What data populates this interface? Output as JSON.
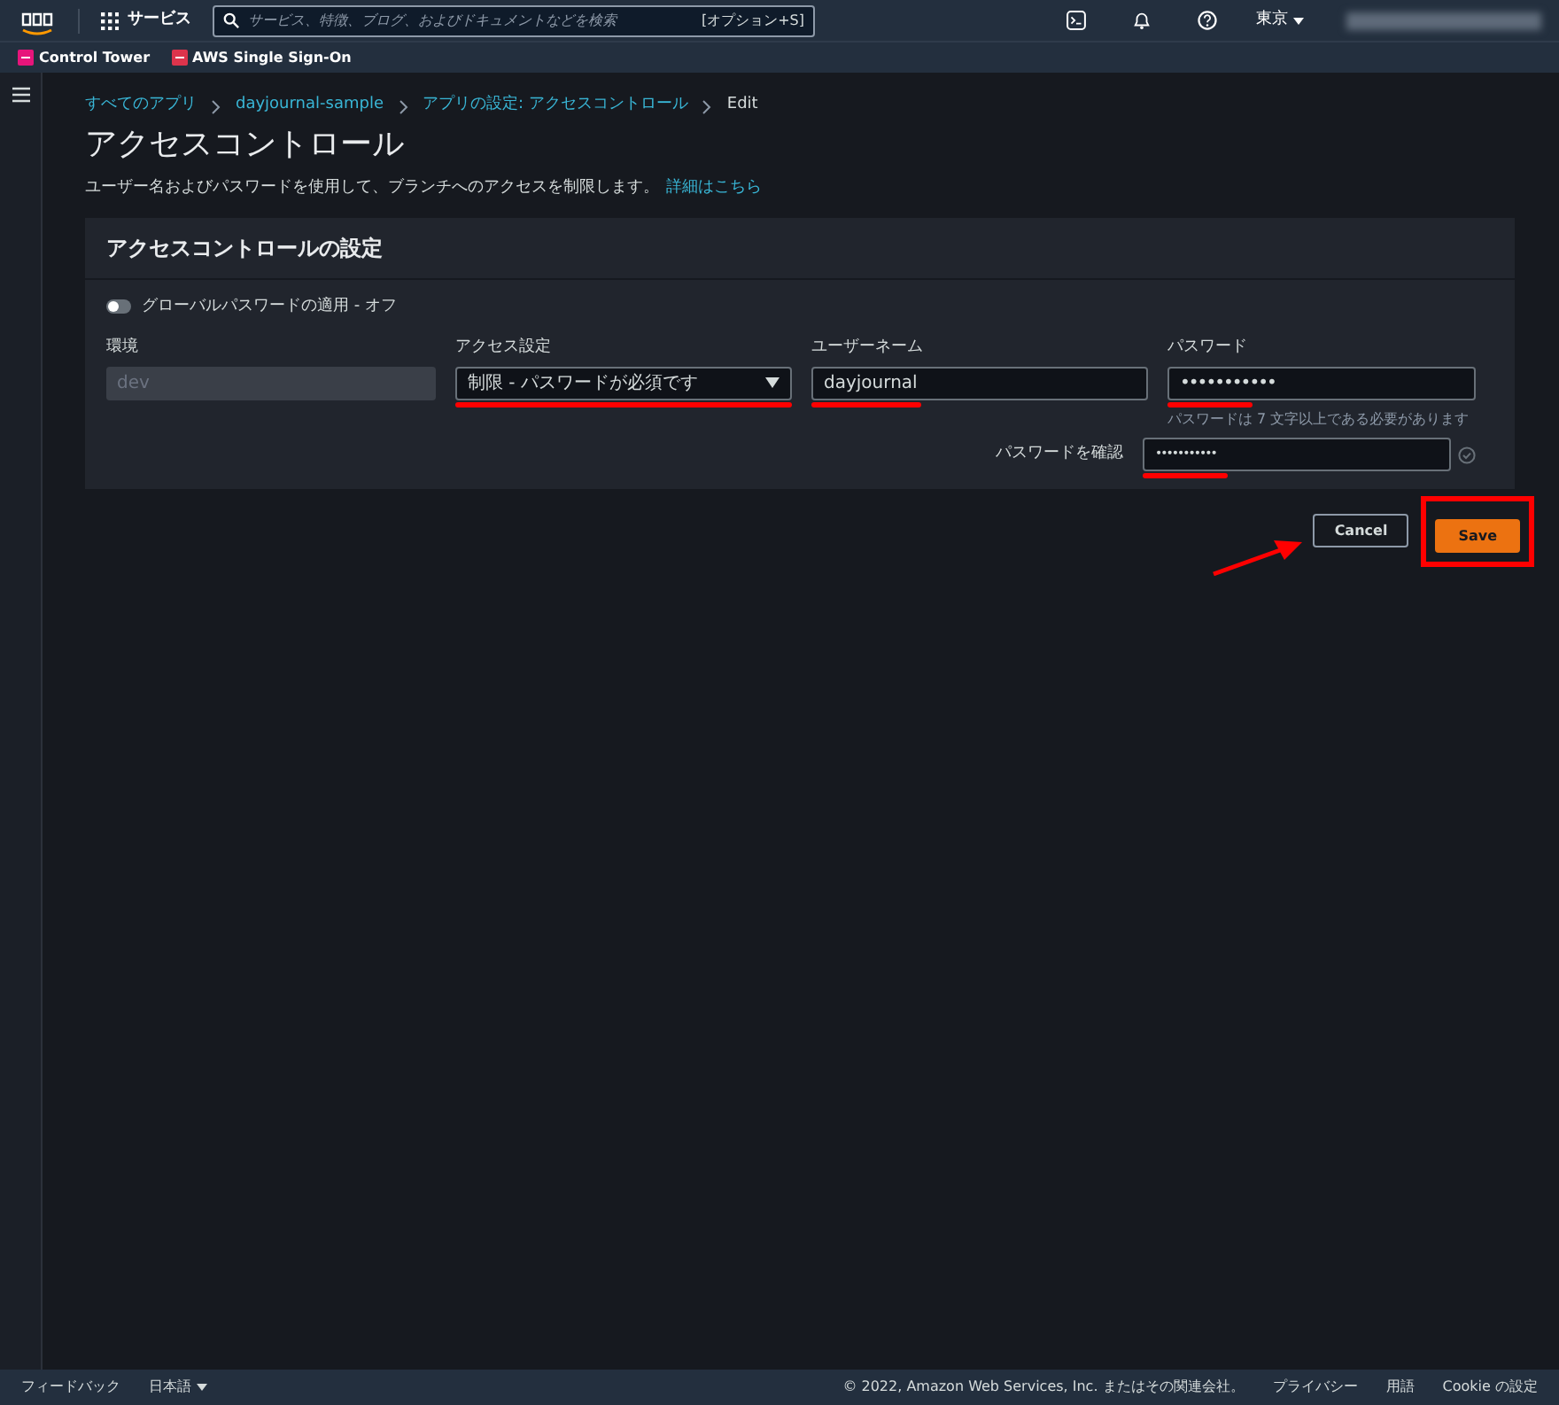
{
  "topbar": {
    "services": "サービス",
    "search": {
      "placeholder": "サービス、特徴、ブログ、およびドキュメントなどを検索"
    },
    "shortcut": "[オプション+S]",
    "region": "東京"
  },
  "bookmarks": [
    {
      "label": "Control Tower"
    },
    {
      "label": "AWS Single Sign-On"
    }
  ],
  "breadcrumbs": [
    {
      "label": "すべてのアプリ",
      "link": true
    },
    {
      "label": "dayjournal-sample",
      "link": true
    },
    {
      "label": "アプリの設定: アクセスコントロール",
      "link": true
    },
    {
      "label": "Edit",
      "link": false
    }
  ],
  "page": {
    "title": "アクセスコントロール",
    "description": "ユーザー名およびパスワードを使用して、ブランチへのアクセスを制限します。",
    "link": "詳細はこちら"
  },
  "panel": {
    "title": "アクセスコントロールの設定",
    "toggle": {
      "label": "グローバルパスワードの適用 - オフ",
      "on": false
    },
    "fields": [
      {
        "label": "環境",
        "value": "dev",
        "kind": "disabled"
      },
      {
        "label": "アクセス設定",
        "value": "制限 - パスワードが必須です",
        "kind": "select"
      },
      {
        "label": "ユーザーネーム",
        "value": "dayjournal",
        "kind": "text"
      },
      {
        "label": "パスワード",
        "value": "•••••••••••",
        "kind": "password",
        "hint": "パスワードは 7 文字以上である必要があります"
      }
    ],
    "confirm": {
      "label": "パスワードを確認",
      "value": "•••••••••••",
      "valid": true
    }
  },
  "buttons": [
    {
      "label": "Cancel",
      "kind": "secondary"
    },
    {
      "label": "Save",
      "kind": "primary"
    }
  ],
  "footer": {
    "feedback": "フィードバック",
    "language": "日本語",
    "copyright": "© 2022, Amazon Web Services, Inc. またはその関連会社。",
    "links": [
      "プライバシー",
      "用語",
      "Cookie の設定"
    ]
  }
}
